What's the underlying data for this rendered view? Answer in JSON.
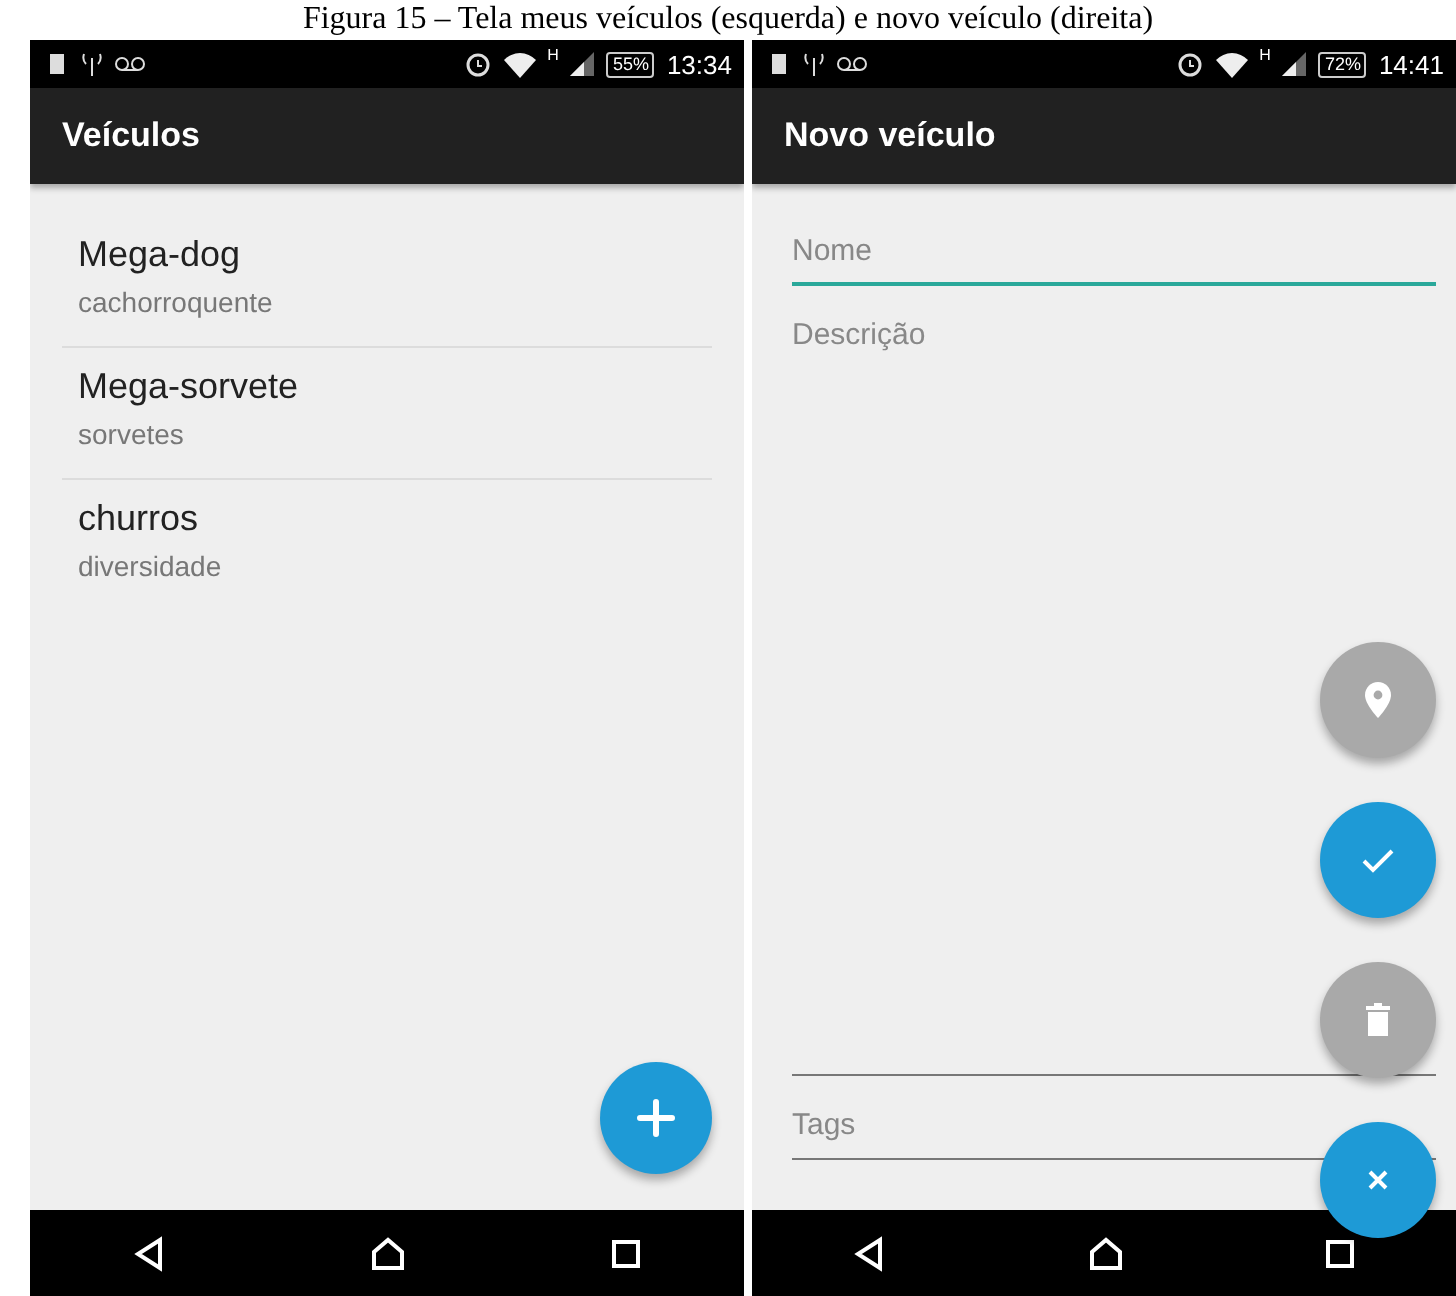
{
  "caption": "Figura 15 – Tela meus veículos (esquerda) e novo veículo (direita)",
  "screens": [
    {
      "kind": "list",
      "status_bar": {
        "network": "H",
        "battery": "55%",
        "time": "13:34"
      },
      "app_bar": {
        "title": "Veículos"
      },
      "items": [
        {
          "title": "Mega-dog",
          "subtitle": "cachorroquente"
        },
        {
          "title": "Mega-sorvete",
          "subtitle": "sorvetes"
        },
        {
          "title": "churros",
          "subtitle": "diversidade"
        }
      ],
      "actions": [
        {
          "kind": "add",
          "color": "#1e9ad6"
        }
      ]
    },
    {
      "kind": "form",
      "status_bar": {
        "network": "H",
        "battery": "72%",
        "time": "14:41"
      },
      "app_bar": {
        "title": "Novo veículo"
      },
      "fields": [
        {
          "placeholder": "Nome",
          "focused": true,
          "multiline": false
        },
        {
          "placeholder": "Descrição",
          "focused": false,
          "multiline": true
        },
        {
          "placeholder": "Tags",
          "focused": false,
          "multiline": false
        }
      ],
      "actions": [
        {
          "kind": "location",
          "color": "#a9a9a9"
        },
        {
          "kind": "confirm",
          "color": "#1e9ad6"
        },
        {
          "kind": "delete",
          "color": "#a9a9a9"
        },
        {
          "kind": "close",
          "color": "#1e9ad6"
        }
      ]
    }
  ]
}
